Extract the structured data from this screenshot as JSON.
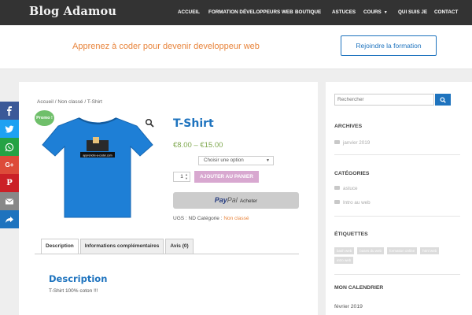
{
  "header": {
    "logo": "Blog Adamou",
    "nav": [
      {
        "label": "ACCUEIL"
      },
      {
        "label": "FORMATION DÉVELOPPEURS WEB"
      },
      {
        "label": "BOUTIQUE"
      },
      {
        "label": "ASTUCES"
      },
      {
        "label": "COURS"
      },
      {
        "label": "QUI SUIS JE"
      },
      {
        "label": "CONTACT"
      }
    ]
  },
  "hero": {
    "tagline": "Apprenez à coder pour devenir developpeur web",
    "cta": "Rejoindre la formation"
  },
  "social": [
    "facebook-icon",
    "twitter-icon",
    "whatsapp-icon",
    "google-plus-icon",
    "pinterest-icon",
    "email-icon",
    "share-icon"
  ],
  "product": {
    "breadcrumb": "Accueil / Non classé / T-Shirt",
    "badge": "Promo !",
    "shirt_print": "apprendre-a-coder.com",
    "title": "T-Shirt",
    "price": "€8.00 – €15.00",
    "variation_placeholder": "Choisir une option",
    "quantity": "1",
    "add_to_cart": "AJOUTER AU PANIER",
    "paypal": {
      "brand_a": "Pay",
      "brand_b": "Pal",
      "label": "Acheter"
    },
    "sku_label": "UGS :",
    "sku_value": "ND",
    "category_label": "Catégorie :",
    "category_value": "Non classé",
    "tabs": [
      {
        "label": "Description"
      },
      {
        "label": "Informations complémentaires"
      },
      {
        "label": "Avis (0)"
      }
    ],
    "description_title": "Description",
    "description_text": "T-Shirt 100% coton !!!",
    "colors": {
      "shirt": "#1e7fd6",
      "accent": "#1e73be",
      "price": "#7fa84f",
      "cart_button": "#d8a8d0",
      "badge": "#6fbf6a"
    }
  },
  "sidebar": {
    "search_placeholder": "Rechercher",
    "archives_title": "ARCHIVES",
    "archives": [
      "janvier 2019"
    ],
    "categories_title": "CATÉGORIES",
    "categories": [
      "astuce",
      "Intro au web"
    ],
    "tags_title": "ÉTIQUETTES",
    "tags": [
      "bash web",
      "bases du web",
      "formation online",
      "html web",
      "intro web"
    ],
    "calendar_title": "MON CALENDRIER",
    "calendar_month": "février 2019"
  }
}
